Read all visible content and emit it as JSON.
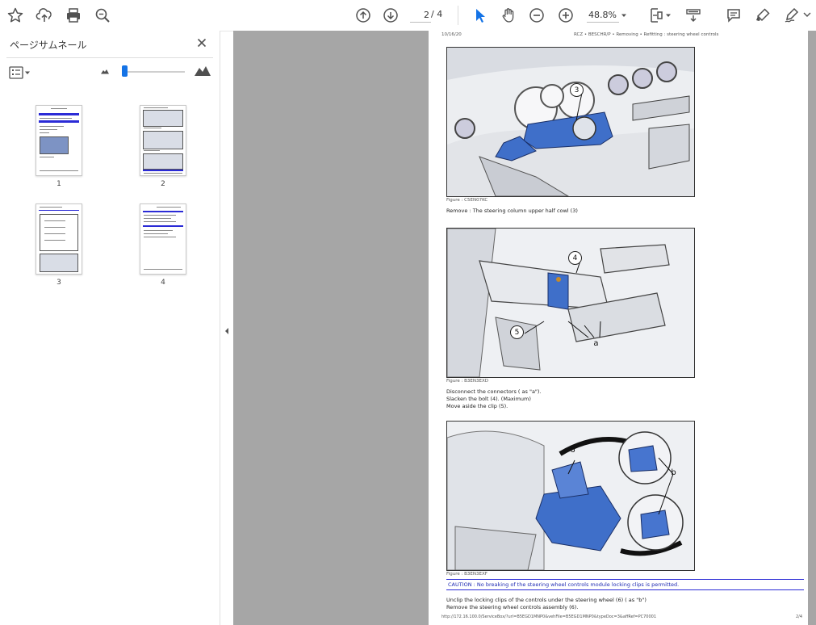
{
  "toolbar": {
    "icons": [
      "star-icon",
      "cloud-upload-icon",
      "print-icon",
      "zoom-search-icon",
      "previous-page-icon",
      "next-page-icon",
      "select-cursor-icon",
      "hand-tool-icon",
      "zoom-out-icon",
      "zoom-in-icon",
      "page-fit-icon",
      "scrolling-mode-icon",
      "comment-icon",
      "highlight-icon",
      "sign-icon"
    ],
    "current_page": "2",
    "total_pages": "/ 4",
    "zoom": "48.8%",
    "accent_color": "#1473e6"
  },
  "sidebar": {
    "title": "ページサムネール",
    "thumbnails": [
      {
        "label": "1"
      },
      {
        "label": "2"
      },
      {
        "label": "3"
      },
      {
        "label": "4"
      }
    ]
  },
  "document": {
    "header_left": "10/16/20",
    "header_right": "RCZ • BESCHR/P • Removing • Refitting : steering wheel controls",
    "figures": [
      {
        "caption": "Figure : C5EN07KC",
        "callouts": [
          "3"
        ]
      },
      {
        "caption": "Figure : B3EN3EXD",
        "callouts": [
          "4",
          "5",
          "a"
        ]
      },
      {
        "caption": "Figure : B3EN3EXF",
        "callouts": [
          "6",
          "b"
        ]
      }
    ],
    "text_1": "Remove : The steering column upper half cowl (3)",
    "text_2": "Disconnect the connectors ( as \"a\").",
    "text_3": "Slacken the bolt (4). (Maximum)",
    "text_4": "Move aside the clip (5).",
    "caution": "CAUTION : No breaking of the steering wheel controls module locking clips is permitted.",
    "text_5": "Unclip the locking clips of the controls under the steering wheel (6) ( as \"b\")",
    "text_6": "Remove the steering wheel controls assembly (6).",
    "footer_left": "http://172.16.100.0/ServiceBox/?url=B5EGD1MNP0&vehFile=B5EGD1MNP0&typeDoc=3&affRef=PC70001",
    "footer_right": "2/4"
  }
}
